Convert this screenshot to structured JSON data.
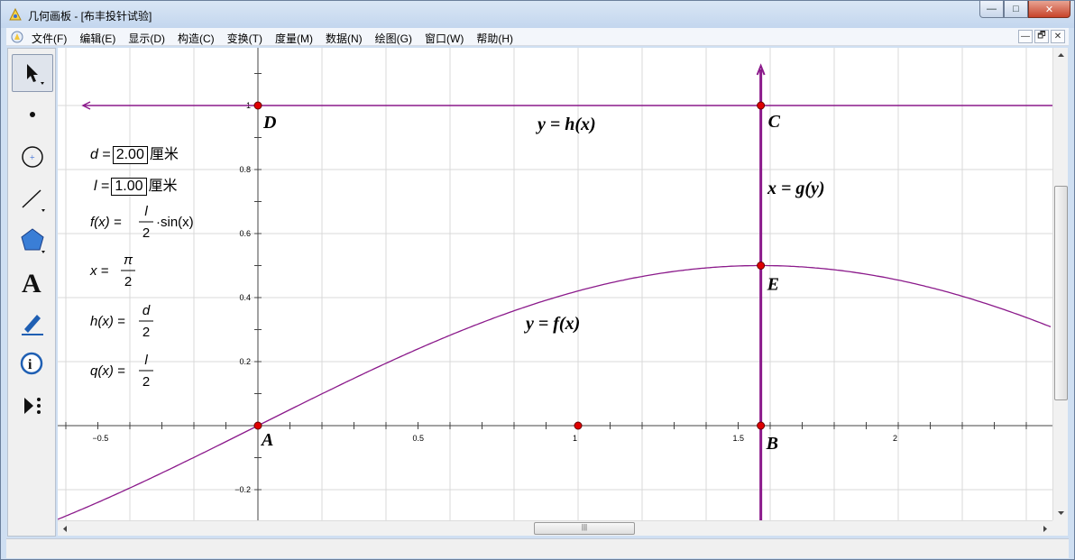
{
  "window": {
    "title": "几何画板 - [布丰投针试验]"
  },
  "window_buttons": {
    "minimize": "—",
    "maximize": "□",
    "close": "✕"
  },
  "menu": {
    "items": [
      "文件(F)",
      "编辑(E)",
      "显示(D)",
      "构造(C)",
      "变换(T)",
      "度量(M)",
      "数据(N)",
      "绘图(G)",
      "窗口(W)",
      "帮助(H)"
    ],
    "mdi_buttons": [
      "—",
      "🗗",
      "✕"
    ]
  },
  "toolbar": {
    "tools": [
      "arrow-select",
      "point",
      "compass",
      "straightedge",
      "polygon",
      "text",
      "marker",
      "information",
      "custom-tools"
    ]
  },
  "params": {
    "d": {
      "name": "d",
      "value": "2.00",
      "unit": "厘米"
    },
    "l": {
      "name": "l",
      "value": "1.00",
      "unit": "厘米"
    }
  },
  "expressions": {
    "f": {
      "lhs": "f(x) =",
      "num": "l",
      "den": "2",
      "tail": "·sin(x)"
    },
    "x": {
      "lhs": "x =",
      "num": "π",
      "den": "2"
    },
    "h": {
      "lhs": "h(x) =",
      "num": "d",
      "den": "2"
    },
    "q": {
      "lhs": "q(x) =",
      "num": "l",
      "den": "2"
    }
  },
  "graph": {
    "x_ticks": [
      "−0.5",
      "0.5",
      "1",
      "1.5",
      "2"
    ],
    "y_ticks": [
      "1",
      "0.8",
      "0.6",
      "0.4",
      "0.2",
      "−0.2"
    ],
    "points": [
      "A",
      "B",
      "C",
      "D",
      "E"
    ],
    "function_labels": {
      "h": "y = h(x)",
      "g": "x = g(y)",
      "f": "y = f(x)"
    }
  },
  "colors": {
    "curve": "#8b1a8b",
    "point_fill": "#e00000",
    "grid": "#d8d8d8"
  },
  "scrollbar": {
    "grip": "|||"
  }
}
